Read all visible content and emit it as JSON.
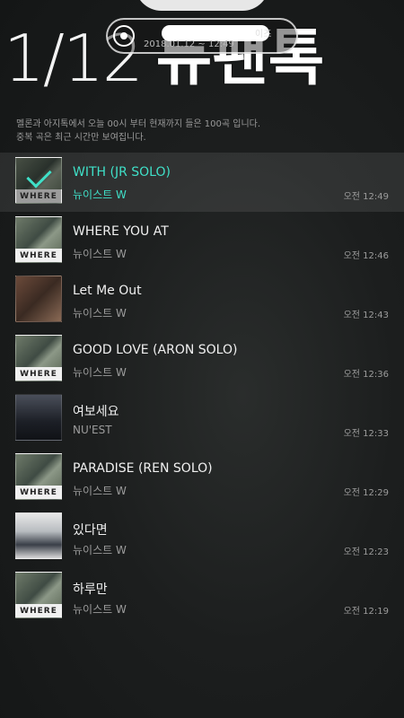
{
  "header": {
    "big_date": "1/12",
    "big_name": "뉴팬톡",
    "pill_date": "2018.01.12 ~ 12:49",
    "pill_extra": "이즈"
  },
  "info": {
    "line1": "멜론과 아지톡에서 오늘 00시 부터 현재까지 들은 100곡 입니다.",
    "line2": "중복 곡은 최근 시간만 보여집니다."
  },
  "songs": [
    {
      "title": "WITH (JR SOLO)",
      "artist": "뉴이스트 W",
      "time": "오전 12:49",
      "cover": "where-icon",
      "selected": true
    },
    {
      "title": "WHERE YOU AT",
      "artist": "뉴이스트 W",
      "time": "오전 12:46",
      "cover": "where-icon"
    },
    {
      "title": "Let Me Out",
      "artist": "뉴이스트 W",
      "time": "오전 12:43",
      "cover": "letmeout-icon"
    },
    {
      "title": "GOOD LOVE (ARON SOLO)",
      "artist": "뉴이스트 W",
      "time": "오전 12:36",
      "cover": "where-icon"
    },
    {
      "title": "여보세요",
      "artist": "NU'EST",
      "time": "오전 12:33",
      "cover": "hello-icon"
    },
    {
      "title": "PARADISE (REN SOLO)",
      "artist": "뉴이스트 W",
      "time": "오전 12:29",
      "cover": "where-icon"
    },
    {
      "title": "있다면",
      "artist": "뉴이스트 W",
      "time": "오전 12:23",
      "cover": "if-icon"
    },
    {
      "title": "하루만",
      "artist": "뉴이스트 W",
      "time": "오전 12:19",
      "cover": "where-icon"
    }
  ],
  "cover_text": "WHERE",
  "colors": {
    "accent": "#3fe0c8",
    "subtext": "#9c9c9c"
  }
}
